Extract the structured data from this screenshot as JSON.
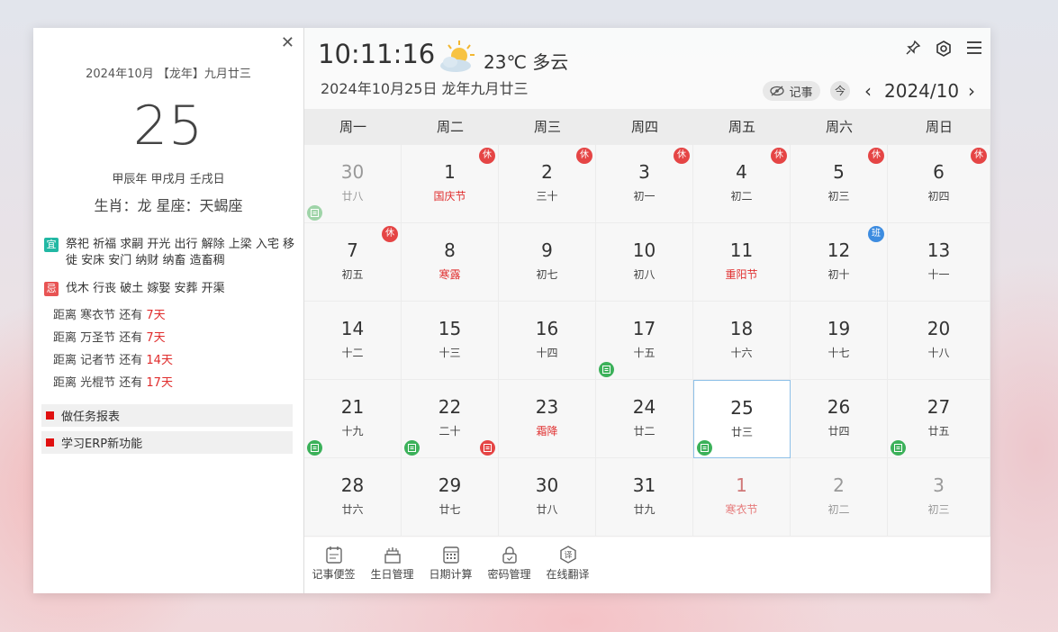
{
  "left": {
    "date_line": "2024年10月  【龙年】九月廿三",
    "day": "25",
    "ganzhi": "甲辰年 甲戌月 壬戌日",
    "zodiac": "生肖：龙 星座：天蝎座",
    "yi_label": "宜",
    "yi_text": "祭祀 祈福 求嗣 开光 出行 解除 上梁 入宅 移徙 安床 安门 纳财 纳畜 造畜稠",
    "ji_label": "忌",
    "ji_text": "伐木 行丧 破土 嫁娶 安葬 开渠",
    "countdowns": [
      {
        "prefix": "距离 寒衣节 还有",
        "days": "7天"
      },
      {
        "prefix": "距离 万圣节 还有",
        "days": "7天"
      },
      {
        "prefix": "距离 记者节 还有",
        "days": "14天"
      },
      {
        "prefix": "距离 光棍节 还有",
        "days": "17天"
      }
    ],
    "todos": [
      "做任务报表",
      "学习ERP新功能"
    ],
    "close_label": "✕"
  },
  "header": {
    "time": "10:11:16",
    "weather_icon": "partly-cloudy-icon",
    "temperature": "23℃ 多云",
    "full_date": "2024年10月25日 龙年九月廿三",
    "memo_label": "记事",
    "today_label": "今",
    "month_label": "2024/10",
    "prev_icon": "‹",
    "next_icon": "›"
  },
  "weekdays": [
    "周一",
    "周二",
    "周三",
    "周四",
    "周五",
    "周六",
    "周日"
  ],
  "calendar": {
    "rest_label": "休",
    "work_label": "班",
    "colors": {
      "rest": "#e54545",
      "work": "#3d8ce0",
      "memo": "#3cb15a",
      "festival": "#e03030",
      "selected_border": "#8ec0e8"
    },
    "cells": [
      {
        "day": "30",
        "lunar": "廿八",
        "other": true,
        "memo": "faded"
      },
      {
        "day": "1",
        "lunar": "国庆节",
        "fest": true,
        "rest": true
      },
      {
        "day": "2",
        "lunar": "三十",
        "rest": true
      },
      {
        "day": "3",
        "lunar": "初一",
        "rest": true
      },
      {
        "day": "4",
        "lunar": "初二",
        "rest": true
      },
      {
        "day": "5",
        "lunar": "初三",
        "rest": true
      },
      {
        "day": "6",
        "lunar": "初四",
        "rest": true
      },
      {
        "day": "7",
        "lunar": "初五",
        "rest": true
      },
      {
        "day": "8",
        "lunar": "寒露",
        "fest": true
      },
      {
        "day": "9",
        "lunar": "初七"
      },
      {
        "day": "10",
        "lunar": "初八"
      },
      {
        "day": "11",
        "lunar": "重阳节",
        "fest": true
      },
      {
        "day": "12",
        "lunar": "初十",
        "work": true
      },
      {
        "day": "13",
        "lunar": "十一"
      },
      {
        "day": "14",
        "lunar": "十二"
      },
      {
        "day": "15",
        "lunar": "十三"
      },
      {
        "day": "16",
        "lunar": "十四"
      },
      {
        "day": "17",
        "lunar": "十五",
        "memo": "green"
      },
      {
        "day": "18",
        "lunar": "十六"
      },
      {
        "day": "19",
        "lunar": "十七"
      },
      {
        "day": "20",
        "lunar": "十八"
      },
      {
        "day": "21",
        "lunar": "十九",
        "memo": "green"
      },
      {
        "day": "22",
        "lunar": "二十",
        "memo": "green",
        "birthday": true
      },
      {
        "day": "23",
        "lunar": "霜降",
        "fest": true
      },
      {
        "day": "24",
        "lunar": "廿二"
      },
      {
        "day": "25",
        "lunar": "廿三",
        "memo": "green",
        "selected": true
      },
      {
        "day": "26",
        "lunar": "廿四"
      },
      {
        "day": "27",
        "lunar": "廿五",
        "memo": "green"
      },
      {
        "day": "28",
        "lunar": "廿六"
      },
      {
        "day": "29",
        "lunar": "廿七"
      },
      {
        "day": "30",
        "lunar": "廿八"
      },
      {
        "day": "31",
        "lunar": "廿九"
      },
      {
        "day": "1",
        "lunar": "寒衣节",
        "fest": true,
        "other": true
      },
      {
        "day": "2",
        "lunar": "初二",
        "other": true
      },
      {
        "day": "3",
        "lunar": "初三",
        "other": true
      }
    ]
  },
  "footer": {
    "tools": [
      {
        "label": "记事便签",
        "icon": "notepad-icon"
      },
      {
        "label": "生日管理",
        "icon": "cake-icon"
      },
      {
        "label": "日期计算",
        "icon": "calculator-icon"
      },
      {
        "label": "密码管理",
        "icon": "lock-icon"
      },
      {
        "label": "在线翻译",
        "icon": "translate-icon"
      }
    ]
  },
  "toolbar_icons": [
    "pin-icon",
    "settings-icon",
    "menu-icon"
  ]
}
